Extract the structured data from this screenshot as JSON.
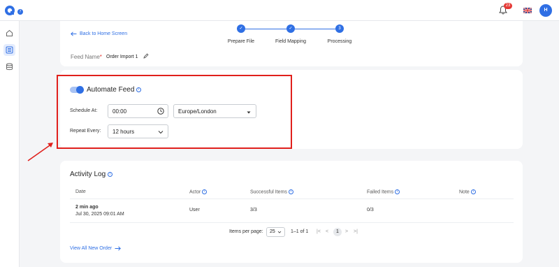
{
  "topbar": {
    "logo_badge": "7",
    "notification_count": "23",
    "avatar_initial": "H"
  },
  "header_card": {
    "back_link": "Back to Home Screen",
    "steps": [
      {
        "label": "Prepare File",
        "state": "complete"
      },
      {
        "label": "Field Mapping",
        "state": "complete"
      },
      {
        "label": "Processing",
        "number": "3",
        "state": "active"
      }
    ],
    "feed_name_label": "Feed Name",
    "required_mark": "*",
    "feed_name_value": "Order Import 1"
  },
  "automate": {
    "title": "Automate Feed",
    "enabled": true,
    "schedule_label": "Schedule At:",
    "schedule_time": "00:00",
    "timezone": "Europe/London",
    "repeat_label": "Repeat Every:",
    "repeat_value": "12 hours"
  },
  "activity_log": {
    "title": "Activity Log",
    "columns": [
      "Date",
      "Actor",
      "Successful Items",
      "Failed Items",
      "Note"
    ],
    "rows": [
      {
        "date_relative": "2 min ago",
        "date_full": "Jul 30, 2025 09:01 AM",
        "actor": "User",
        "successful": "3/3",
        "failed": "0/3",
        "note": ""
      }
    ],
    "pagination": {
      "items_per_page_label": "Items per page:",
      "items_per_page": "25",
      "range": "1–1 of 1",
      "page": "1"
    },
    "view_all": "View All New Order"
  },
  "colors": {
    "accent": "#2f6fe4",
    "highlight": "#e0201c",
    "badge": "#e53935"
  }
}
